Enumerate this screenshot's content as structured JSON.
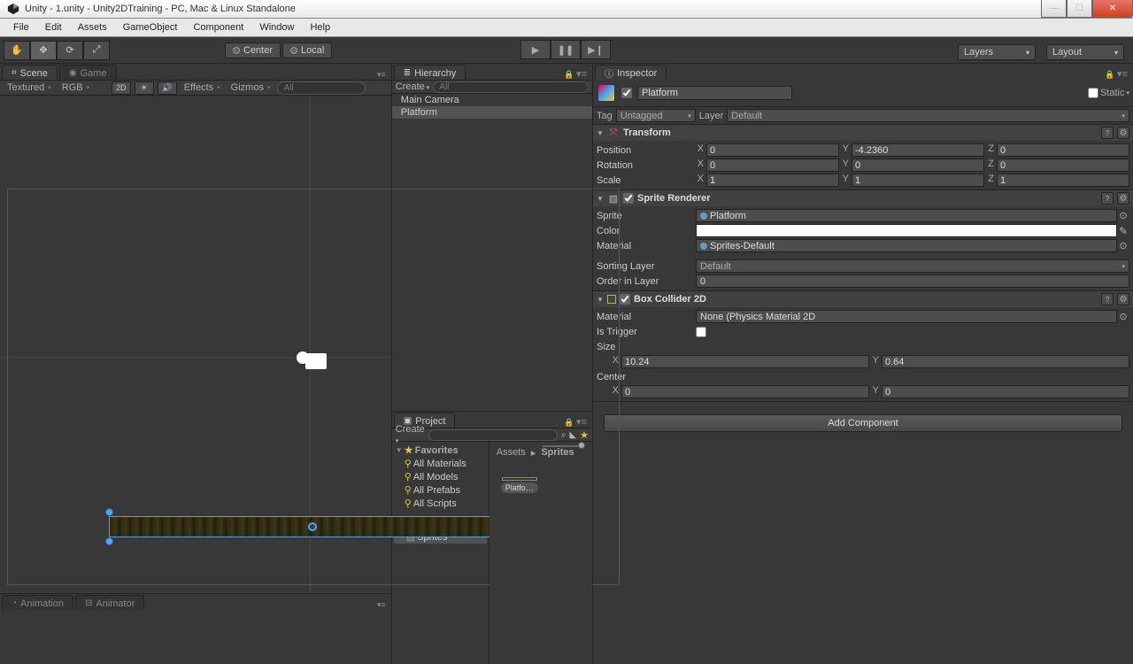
{
  "window": {
    "title": "Unity - 1.unity - Unity2DTraining - PC, Mac & Linux Standalone"
  },
  "menu": [
    "File",
    "Edit",
    "Assets",
    "GameObject",
    "Component",
    "Window",
    "Help"
  ],
  "handle_toggle": {
    "pivot": "Center",
    "space": "Local"
  },
  "layers_dd": "Layers",
  "layout_dd": "Layout",
  "scene": {
    "tabs": {
      "scene": "Scene",
      "game": "Game"
    },
    "shading": "Textured",
    "render": "RGB",
    "mode2d": "2D",
    "effects": "Effects",
    "gizmos": "Gizmos",
    "search_ph": "All"
  },
  "bottom_tabs": {
    "animation": "Animation",
    "animator": "Animator"
  },
  "hierarchy": {
    "title": "Hierarchy",
    "create": "Create",
    "search_ph": "All",
    "items": [
      "Main Camera",
      "Platform"
    ],
    "selected_index": 1
  },
  "project": {
    "title": "Project",
    "create": "Create",
    "favorites_label": "Favorites",
    "favorites": [
      "All Materials",
      "All Models",
      "All Prefabs",
      "All Scripts"
    ],
    "assets_label": "Assets",
    "folders": [
      "Sprites"
    ],
    "breadcrumb": [
      "Assets",
      "Sprites"
    ],
    "thumb_label": "Platfo…"
  },
  "inspector": {
    "title": "Inspector",
    "obj_name": "Platform",
    "static_label": "Static",
    "tag_label": "Tag",
    "tag_value": "Untagged",
    "layer_label": "Layer",
    "layer_value": "Default",
    "transform": {
      "title": "Transform",
      "pos_label": "Position",
      "pos": {
        "x": "0",
        "y": "-4.2360",
        "z": "0"
      },
      "rot_label": "Rotation",
      "rot": {
        "x": "0",
        "y": "0",
        "z": "0"
      },
      "scl_label": "Scale",
      "scl": {
        "x": "1",
        "y": "1",
        "z": "1"
      }
    },
    "sprite_renderer": {
      "title": "Sprite Renderer",
      "sprite_label": "Sprite",
      "sprite_value": "Platform",
      "color_label": "Color",
      "material_label": "Material",
      "material_value": "Sprites-Default",
      "sorting_layer_label": "Sorting Layer",
      "sorting_layer_value": "Default",
      "order_label": "Order in Layer",
      "order_value": "0"
    },
    "box_collider": {
      "title": "Box Collider 2D",
      "material_label": "Material",
      "material_value": "None (Physics Material 2D",
      "trigger_label": "Is Trigger",
      "size_label": "Size",
      "size": {
        "x": "10.24",
        "y": "0.64"
      },
      "center_label": "Center",
      "center": {
        "x": "0",
        "y": "0"
      }
    },
    "add_component": "Add Component"
  }
}
